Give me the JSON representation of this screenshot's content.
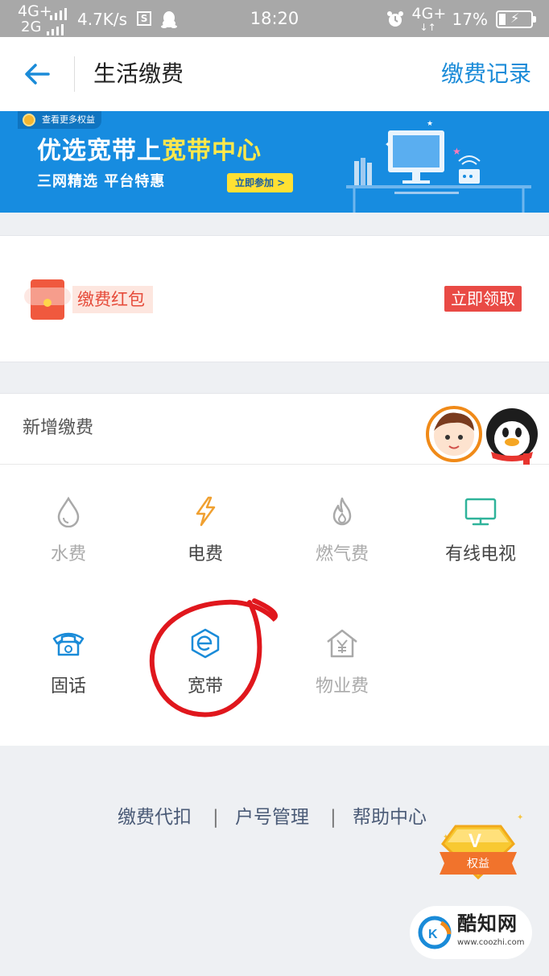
{
  "status_bar": {
    "net1": "4G+",
    "net2": "2G",
    "speed": "4.7K/s",
    "s_badge": "S",
    "time": "18:20",
    "net_right": "4G+",
    "battery": "17%"
  },
  "nav": {
    "title": "生活缴费",
    "records": "缴费记录"
  },
  "banner": {
    "tag": "查看更多权益",
    "headline_prefix": "优选宽带上",
    "headline_highlight": "宽带中心",
    "subtitle": "三网精选  平台特惠",
    "cta": "立即参加 >"
  },
  "red_packet": {
    "label": "缴费红包",
    "claim_button": "立即领取"
  },
  "new_payment": {
    "title": "新增缴费",
    "items": [
      {
        "label": "水费",
        "icon": "water-drop-icon",
        "enabled": false
      },
      {
        "label": "电费",
        "icon": "lightning-icon",
        "enabled": true
      },
      {
        "label": "燃气费",
        "icon": "flame-icon",
        "enabled": false
      },
      {
        "label": "有线电视",
        "icon": "tv-icon",
        "enabled": true
      },
      {
        "label": "固话",
        "icon": "telephone-icon",
        "enabled": true
      },
      {
        "label": "宽带",
        "icon": "broadband-icon",
        "enabled": true
      },
      {
        "label": "物业费",
        "icon": "house-yen-icon",
        "enabled": false
      }
    ]
  },
  "footer_links": {
    "auto_debit": "缴费代扣",
    "sep1": "|",
    "account_mgmt": "户号管理",
    "sep2": "|",
    "help": "帮助中心"
  },
  "rights_badge": "权益",
  "watermark": {
    "name": "酷知网",
    "url": "www.coozhi.com"
  },
  "colors": {
    "accent_blue": "#1a8bd8",
    "banner_blue": "#178ce0",
    "red": "#e94a45",
    "orange": "#f0a030",
    "green": "#2fb39a"
  }
}
